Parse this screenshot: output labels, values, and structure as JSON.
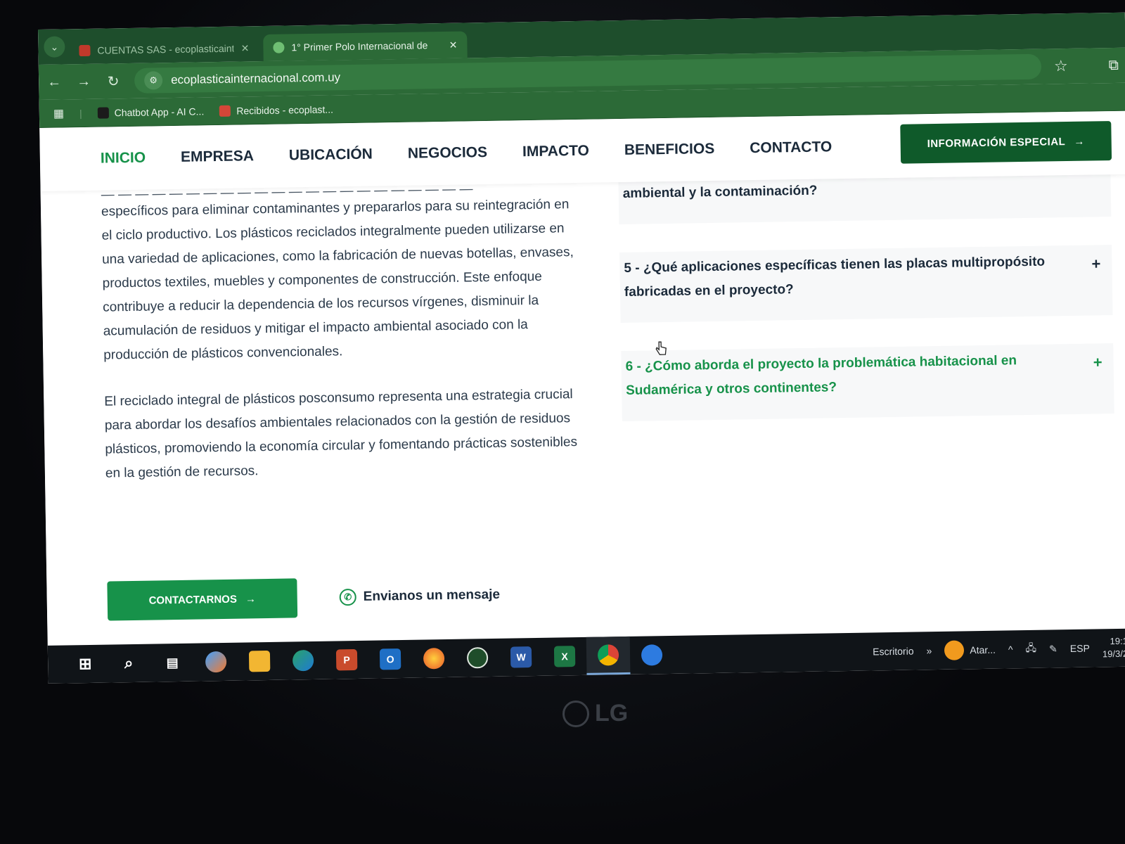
{
  "browser": {
    "tabs": [
      {
        "title": "CUENTAS SAS - ecoplasticaint",
        "active": false
      },
      {
        "title": "1° Primer Polo Internacional de",
        "active": true
      }
    ],
    "address": "ecoplasticainternacional.com.uy",
    "bookmarks": [
      {
        "label": "Chatbot App - AI C..."
      },
      {
        "label": "Recibidos - ecoplast..."
      }
    ]
  },
  "site": {
    "nav": [
      {
        "label": "INICIO",
        "active": true
      },
      {
        "label": "EMPRESA"
      },
      {
        "label": "UBICACIÓN"
      },
      {
        "label": "NEGOCIOS"
      },
      {
        "label": "IMPACTO"
      },
      {
        "label": "BENEFICIOS"
      },
      {
        "label": "CONTACTO"
      }
    ],
    "cta_top": "INFORMACIÓN ESPECIAL",
    "paragraphs": [
      "específicos para eliminar contaminantes y prepararlos para su reintegración en el ciclo productivo. Los plásticos reciclados integralmente pueden utilizarse en una variedad de aplicaciones, como la fabricación de nuevas botellas, envases, productos textiles, muebles y componentes de construcción. Este enfoque contribuye a reducir la dependencia de los recursos vírgenes, disminuir la acumulación de residuos y mitigar el impacto ambiental asociado con la producción de plásticos convencionales.",
      "El reciclado integral de plásticos posconsumo representa una estrategia crucial para abordar los desafíos ambientales relacionados con la gestión de residuos plásticos, promoviendo la economía circular y fomentando prácticas sostenibles en la gestión de recursos."
    ],
    "faq": [
      {
        "question": "ambiental y la contaminación?",
        "open": false
      },
      {
        "question": "5 - ¿Qué aplicaciones específicas tienen las placas multipropósito fabricadas en el proyecto?",
        "open": false
      },
      {
        "question": "6 - ¿Cómo aborda el proyecto la problemática habitacional en Sudamérica y otros continentes?",
        "open": true
      }
    ],
    "cta_contact": "CONTACTARNOS",
    "whatsapp": "Envianos un mensaje"
  },
  "taskbar": {
    "apps": [
      {
        "icon": "windows-start-icon"
      },
      {
        "icon": "search-icon"
      },
      {
        "icon": "task-view-icon"
      },
      {
        "icon": "copilot-icon"
      },
      {
        "icon": "file-explorer-icon"
      },
      {
        "icon": "edge-icon"
      },
      {
        "icon": "powerpoint-icon",
        "glyph": "P"
      },
      {
        "icon": "outlook-icon",
        "glyph": "O"
      },
      {
        "icon": "firefox-icon"
      },
      {
        "icon": "app-icon"
      },
      {
        "icon": "word-icon",
        "glyph": "W"
      },
      {
        "icon": "excel-icon",
        "glyph": "X"
      },
      {
        "icon": "chrome-icon"
      },
      {
        "icon": "messenger-icon"
      }
    ],
    "desktop_label": "Escritorio",
    "weather": "Atar...",
    "language": "ESP",
    "time": "19:1",
    "date": "19/3/2"
  },
  "monitor_brand": "LG"
}
